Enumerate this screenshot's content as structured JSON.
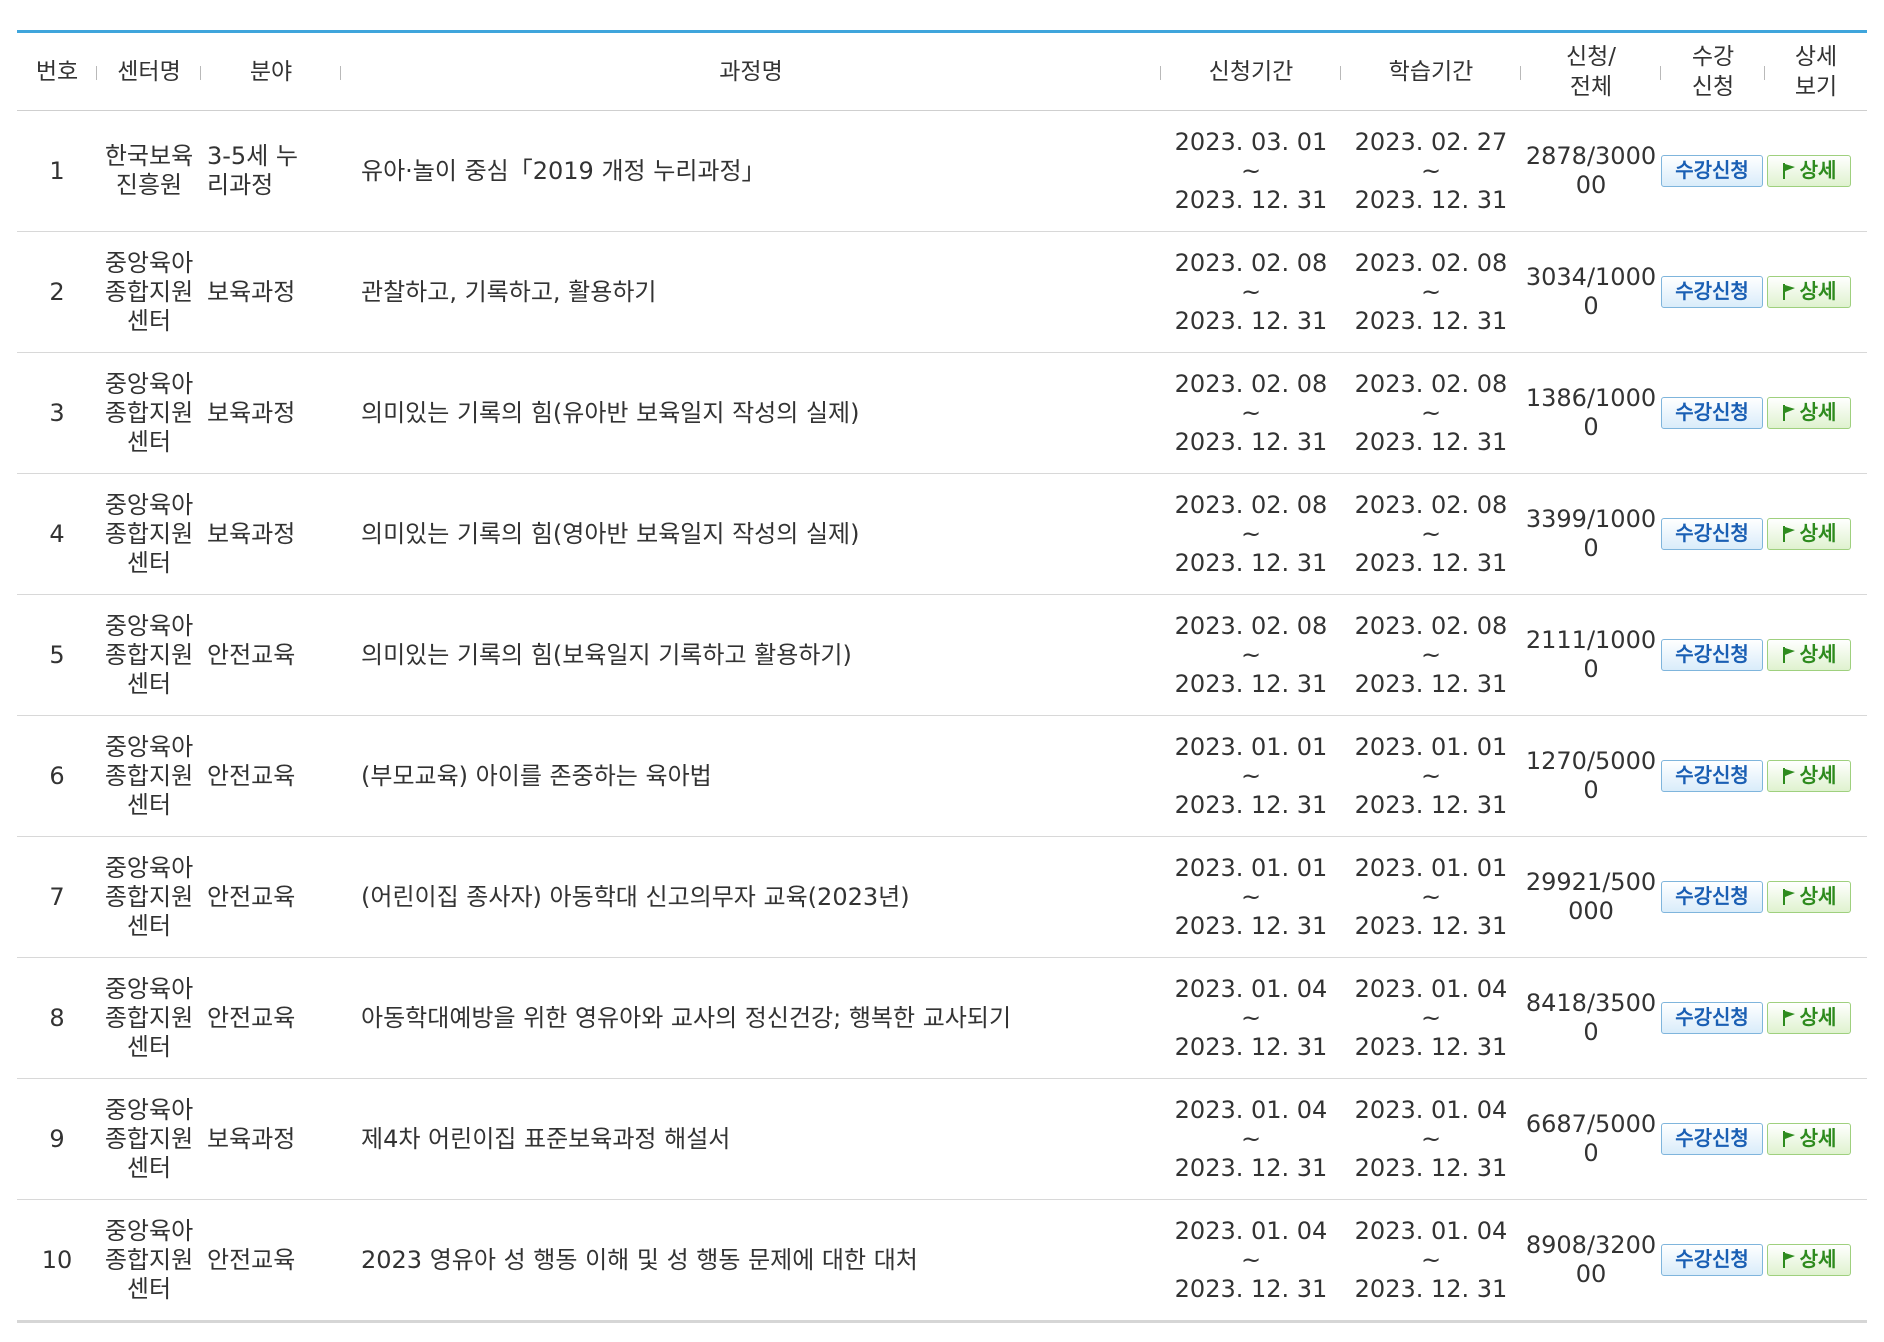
{
  "headers": {
    "no": "번호",
    "center": "센터명",
    "field": "분야",
    "course": "과정명",
    "apply_period": "신청기간",
    "study_period": "학습기간",
    "count_l1": "신청/",
    "count_l2": "전체",
    "enroll_l1": "수강",
    "enroll_l2": "신청",
    "detail_l1": "상세",
    "detail_l2": "보기"
  },
  "buttons": {
    "apply": "수강신청",
    "detail": "상세"
  },
  "tilde": "~",
  "colors": {
    "accent": "#3fa5dc",
    "apply_text": "#1a5fb4",
    "detail_text": "#2e8b1e"
  },
  "rows": [
    {
      "no": "1",
      "center": [
        "한국보육",
        "진흥원"
      ],
      "field": [
        "3-5세 누",
        "리과정"
      ],
      "course": "유아·놀이 중심「2019 개정 누리과정」",
      "apply_start": "2023. 03. 01",
      "apply_end": "2023. 12. 31",
      "study_start": "2023. 02. 27",
      "study_end": "2023. 12. 31",
      "count": "2878/300000"
    },
    {
      "no": "2",
      "center": [
        "중앙육아",
        "종합지원",
        "센터"
      ],
      "field": [
        "보육과정"
      ],
      "course": "관찰하고, 기록하고, 활용하기",
      "apply_start": "2023. 02. 08",
      "apply_end": "2023. 12. 31",
      "study_start": "2023. 02. 08",
      "study_end": "2023. 12. 31",
      "count": "3034/10000"
    },
    {
      "no": "3",
      "center": [
        "중앙육아",
        "종합지원",
        "센터"
      ],
      "field": [
        "보육과정"
      ],
      "course": "의미있는 기록의 힘(유아반 보육일지 작성의 실제)",
      "apply_start": "2023. 02. 08",
      "apply_end": "2023. 12. 31",
      "study_start": "2023. 02. 08",
      "study_end": "2023. 12. 31",
      "count": "1386/10000"
    },
    {
      "no": "4",
      "center": [
        "중앙육아",
        "종합지원",
        "센터"
      ],
      "field": [
        "보육과정"
      ],
      "course": "의미있는 기록의 힘(영아반 보육일지 작성의 실제)",
      "apply_start": "2023. 02. 08",
      "apply_end": "2023. 12. 31",
      "study_start": "2023. 02. 08",
      "study_end": "2023. 12. 31",
      "count": "3399/10000"
    },
    {
      "no": "5",
      "center": [
        "중앙육아",
        "종합지원",
        "센터"
      ],
      "field": [
        "안전교육"
      ],
      "course": "의미있는 기록의 힘(보육일지 기록하고 활용하기)",
      "apply_start": "2023. 02. 08",
      "apply_end": "2023. 12. 31",
      "study_start": "2023. 02. 08",
      "study_end": "2023. 12. 31",
      "count": "2111/10000"
    },
    {
      "no": "6",
      "center": [
        "중앙육아",
        "종합지원",
        "센터"
      ],
      "field": [
        "안전교육"
      ],
      "course": "(부모교육) 아이를 존중하는 육아법",
      "apply_start": "2023. 01. 01",
      "apply_end": "2023. 12. 31",
      "study_start": "2023. 01. 01",
      "study_end": "2023. 12. 31",
      "count": "1270/50000"
    },
    {
      "no": "7",
      "center": [
        "중앙육아",
        "종합지원",
        "센터"
      ],
      "field": [
        "안전교육"
      ],
      "course": "(어린이집 종사자) 아동학대 신고의무자 교육(2023년)",
      "apply_start": "2023. 01. 01",
      "apply_end": "2023. 12. 31",
      "study_start": "2023. 01. 01",
      "study_end": "2023. 12. 31",
      "count": "29921/500000"
    },
    {
      "no": "8",
      "center": [
        "중앙육아",
        "종합지원",
        "센터"
      ],
      "field": [
        "안전교육"
      ],
      "course": "아동학대예방을 위한 영유아와 교사의 정신건강; 행복한 교사되기",
      "apply_start": "2023. 01. 04",
      "apply_end": "2023. 12. 31",
      "study_start": "2023. 01. 04",
      "study_end": "2023. 12. 31",
      "count": "8418/35000"
    },
    {
      "no": "9",
      "center": [
        "중앙육아",
        "종합지원",
        "센터"
      ],
      "field": [
        "보육과정"
      ],
      "course": "제4차 어린이집 표준보육과정 해설서",
      "apply_start": "2023. 01. 04",
      "apply_end": "2023. 12. 31",
      "study_start": "2023. 01. 04",
      "study_end": "2023. 12. 31",
      "count": "6687/50000"
    },
    {
      "no": "10",
      "center": [
        "중앙육아",
        "종합지원",
        "센터"
      ],
      "field": [
        "안전교육"
      ],
      "course": "2023 영유아 성 행동 이해 및 성 행동 문제에 대한 대처",
      "apply_start": "2023. 01. 04",
      "apply_end": "2023. 12. 31",
      "study_start": "2023. 01. 04",
      "study_end": "2023. 12. 31",
      "count": "8908/320000"
    }
  ]
}
